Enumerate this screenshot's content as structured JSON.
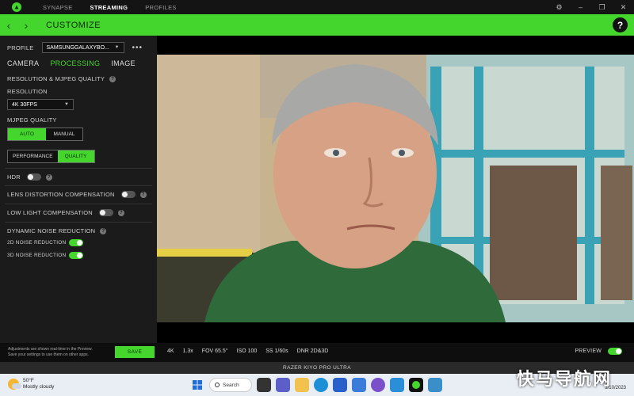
{
  "topbar": {
    "nav": [
      "SYNAPSE",
      "STREAMING",
      "PROFILES"
    ],
    "active_index": 1
  },
  "header": {
    "back_icon": "chevron-left-icon",
    "forward_icon": "chevron-right-icon",
    "title": "CUSTOMIZE",
    "help_label": "?"
  },
  "panel": {
    "profile_label": "PROFILE",
    "profile_value": "SAMSUNGGALAXYBO...",
    "more_label": "•••",
    "tabs": [
      "CAMERA",
      "PROCESSING",
      "IMAGE"
    ],
    "active_tab": 1,
    "section_title": "RESOLUTION & MJPEG QUALITY",
    "resolution_label": "RESOLUTION",
    "resolution_value": "4K 30FPS",
    "mjpeg_label": "MJPEG QUALITY",
    "mjpeg_options": [
      "AUTO",
      "MANUAL"
    ],
    "perf_options": [
      "PERFORMANCE",
      "QUALITY"
    ],
    "hdr_label": "HDR",
    "hdr_on": false,
    "lens_label": "LENS DISTORTION COMPENSATION",
    "lens_on": false,
    "lowlight_label": "LOW LIGHT COMPENSATION",
    "lowlight_on": false,
    "dnr_label": "DYNAMIC NOISE REDUCTION",
    "dnr2d_label": "2D NOISE REDUCTION",
    "dnr2d_on": true,
    "dnr3d_label": "3D NOISE REDUCTION",
    "dnr3d_on": true,
    "info_glyph": "?"
  },
  "bottom": {
    "note_line1": "Adjustments are shown real-time in the Preview.",
    "note_line2": "Save your settings to use them on other apps.",
    "save_label": "SAVE",
    "stats": [
      "4K",
      "1.3x",
      "FOV 65.5°",
      "ISO 100",
      "SS 1/60s",
      "DNR 2D&3D"
    ],
    "preview_label": "PREVIEW",
    "preview_on": true,
    "device_name": "RAZER KIYO PRO ULTRA"
  },
  "taskbar": {
    "temperature": "50°F",
    "condition": "Mostly cloudy",
    "search_label": "Search",
    "date": "3/10/2023"
  },
  "watermark": "快马导航网",
  "colors": {
    "accent": "#44d62c",
    "panel": "#1b1b1b",
    "titlebar": "#141414"
  }
}
